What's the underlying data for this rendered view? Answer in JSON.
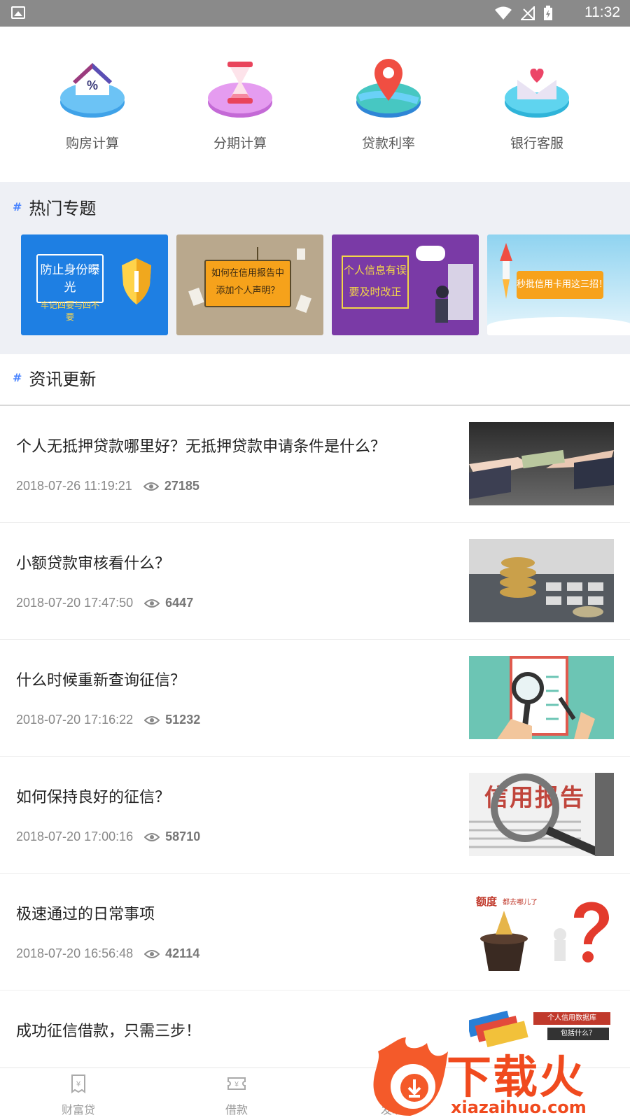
{
  "status_bar": {
    "time": "11:32"
  },
  "quick_actions": [
    {
      "label": "购房计算",
      "icon": "house-percent-icon"
    },
    {
      "label": "分期计算",
      "icon": "hourglass-icon"
    },
    {
      "label": "贷款利率",
      "icon": "map-pin-icon"
    },
    {
      "label": "银行客服",
      "icon": "heart-envelope-icon"
    }
  ],
  "hot_topics": {
    "title": "热门专题",
    "banners": [
      {
        "line1": "防止身份曝光",
        "line2": "牢记四要与四不要",
        "color": "#1e7fe3"
      },
      {
        "line1": "如何在信用报告中",
        "line2": "添加个人声明？",
        "color": "#b9a88d"
      },
      {
        "line1": "个人信息有误",
        "line2": "要及时改正",
        "color": "#7a3aa6"
      },
      {
        "line1": "秒批信用卡用这三招！",
        "line2": "",
        "color": "#8fd3f0"
      }
    ]
  },
  "news": {
    "title": "资讯更新",
    "items": [
      {
        "title": "个人无抵押贷款哪里好？无抵押贷款申请条件是什么？",
        "date": "2018-07-26 11:19:21",
        "views": "27185"
      },
      {
        "title": "小额贷款审核看什么？",
        "date": "2018-07-20 17:47:50",
        "views": "6447"
      },
      {
        "title": "什么时候重新查询征信？",
        "date": "2018-07-20 17:16:22",
        "views": "51232"
      },
      {
        "title": "如何保持良好的征信？",
        "date": "2018-07-20 17:00:16",
        "views": "58710"
      },
      {
        "title": "极速通过的日常事项",
        "date": "2018-07-20 16:56:48",
        "views": "42114"
      },
      {
        "title": "成功征信借款，只需三步！",
        "date": "",
        "views": ""
      }
    ],
    "thumb_texts": {
      "credit_report": "信用报告",
      "quota": "额度",
      "quota_where": "都去哪儿了",
      "db_line1": "个人信用数据库",
      "db_line2": "包括什么？"
    }
  },
  "tabbar": [
    {
      "label": "财富贷",
      "icon": "receipt-yuan-icon"
    },
    {
      "label": "借款",
      "icon": "ticket-yuan-icon"
    },
    {
      "label": "发现",
      "icon": "compass-icon"
    }
  ],
  "watermark": {
    "brand": "下载火",
    "url": "xiazaihuo.com"
  }
}
